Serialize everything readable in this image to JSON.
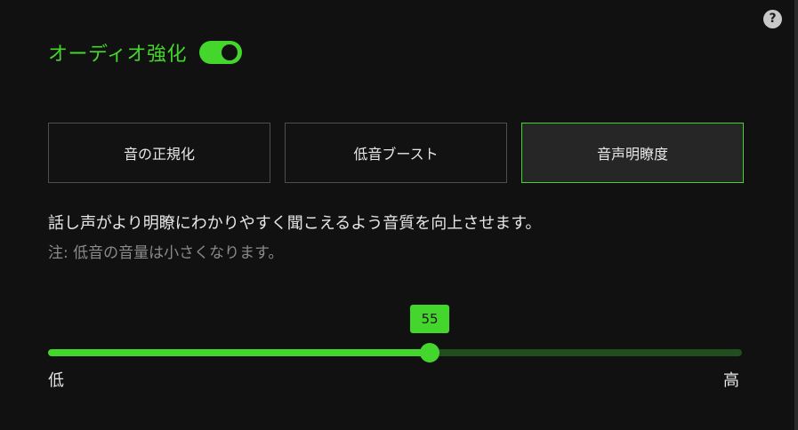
{
  "help": {
    "glyph": "?"
  },
  "header": {
    "title": "オーディオ強化",
    "toggle_on": true
  },
  "modes": [
    {
      "label": "音の正規化",
      "active": false
    },
    {
      "label": "低音ブースト",
      "active": false
    },
    {
      "label": "音声明瞭度",
      "active": true
    }
  ],
  "description": "話し声がより明瞭にわかりやすく聞こえるよう音質を向上させます。",
  "note": "注: 低音の音量は小さくなります。",
  "slider": {
    "value": 55,
    "min": 0,
    "max": 100,
    "min_label": "低",
    "max_label": "高"
  },
  "colors": {
    "accent": "#44d62c",
    "track_bg": "#224d1c",
    "background": "#111111"
  }
}
